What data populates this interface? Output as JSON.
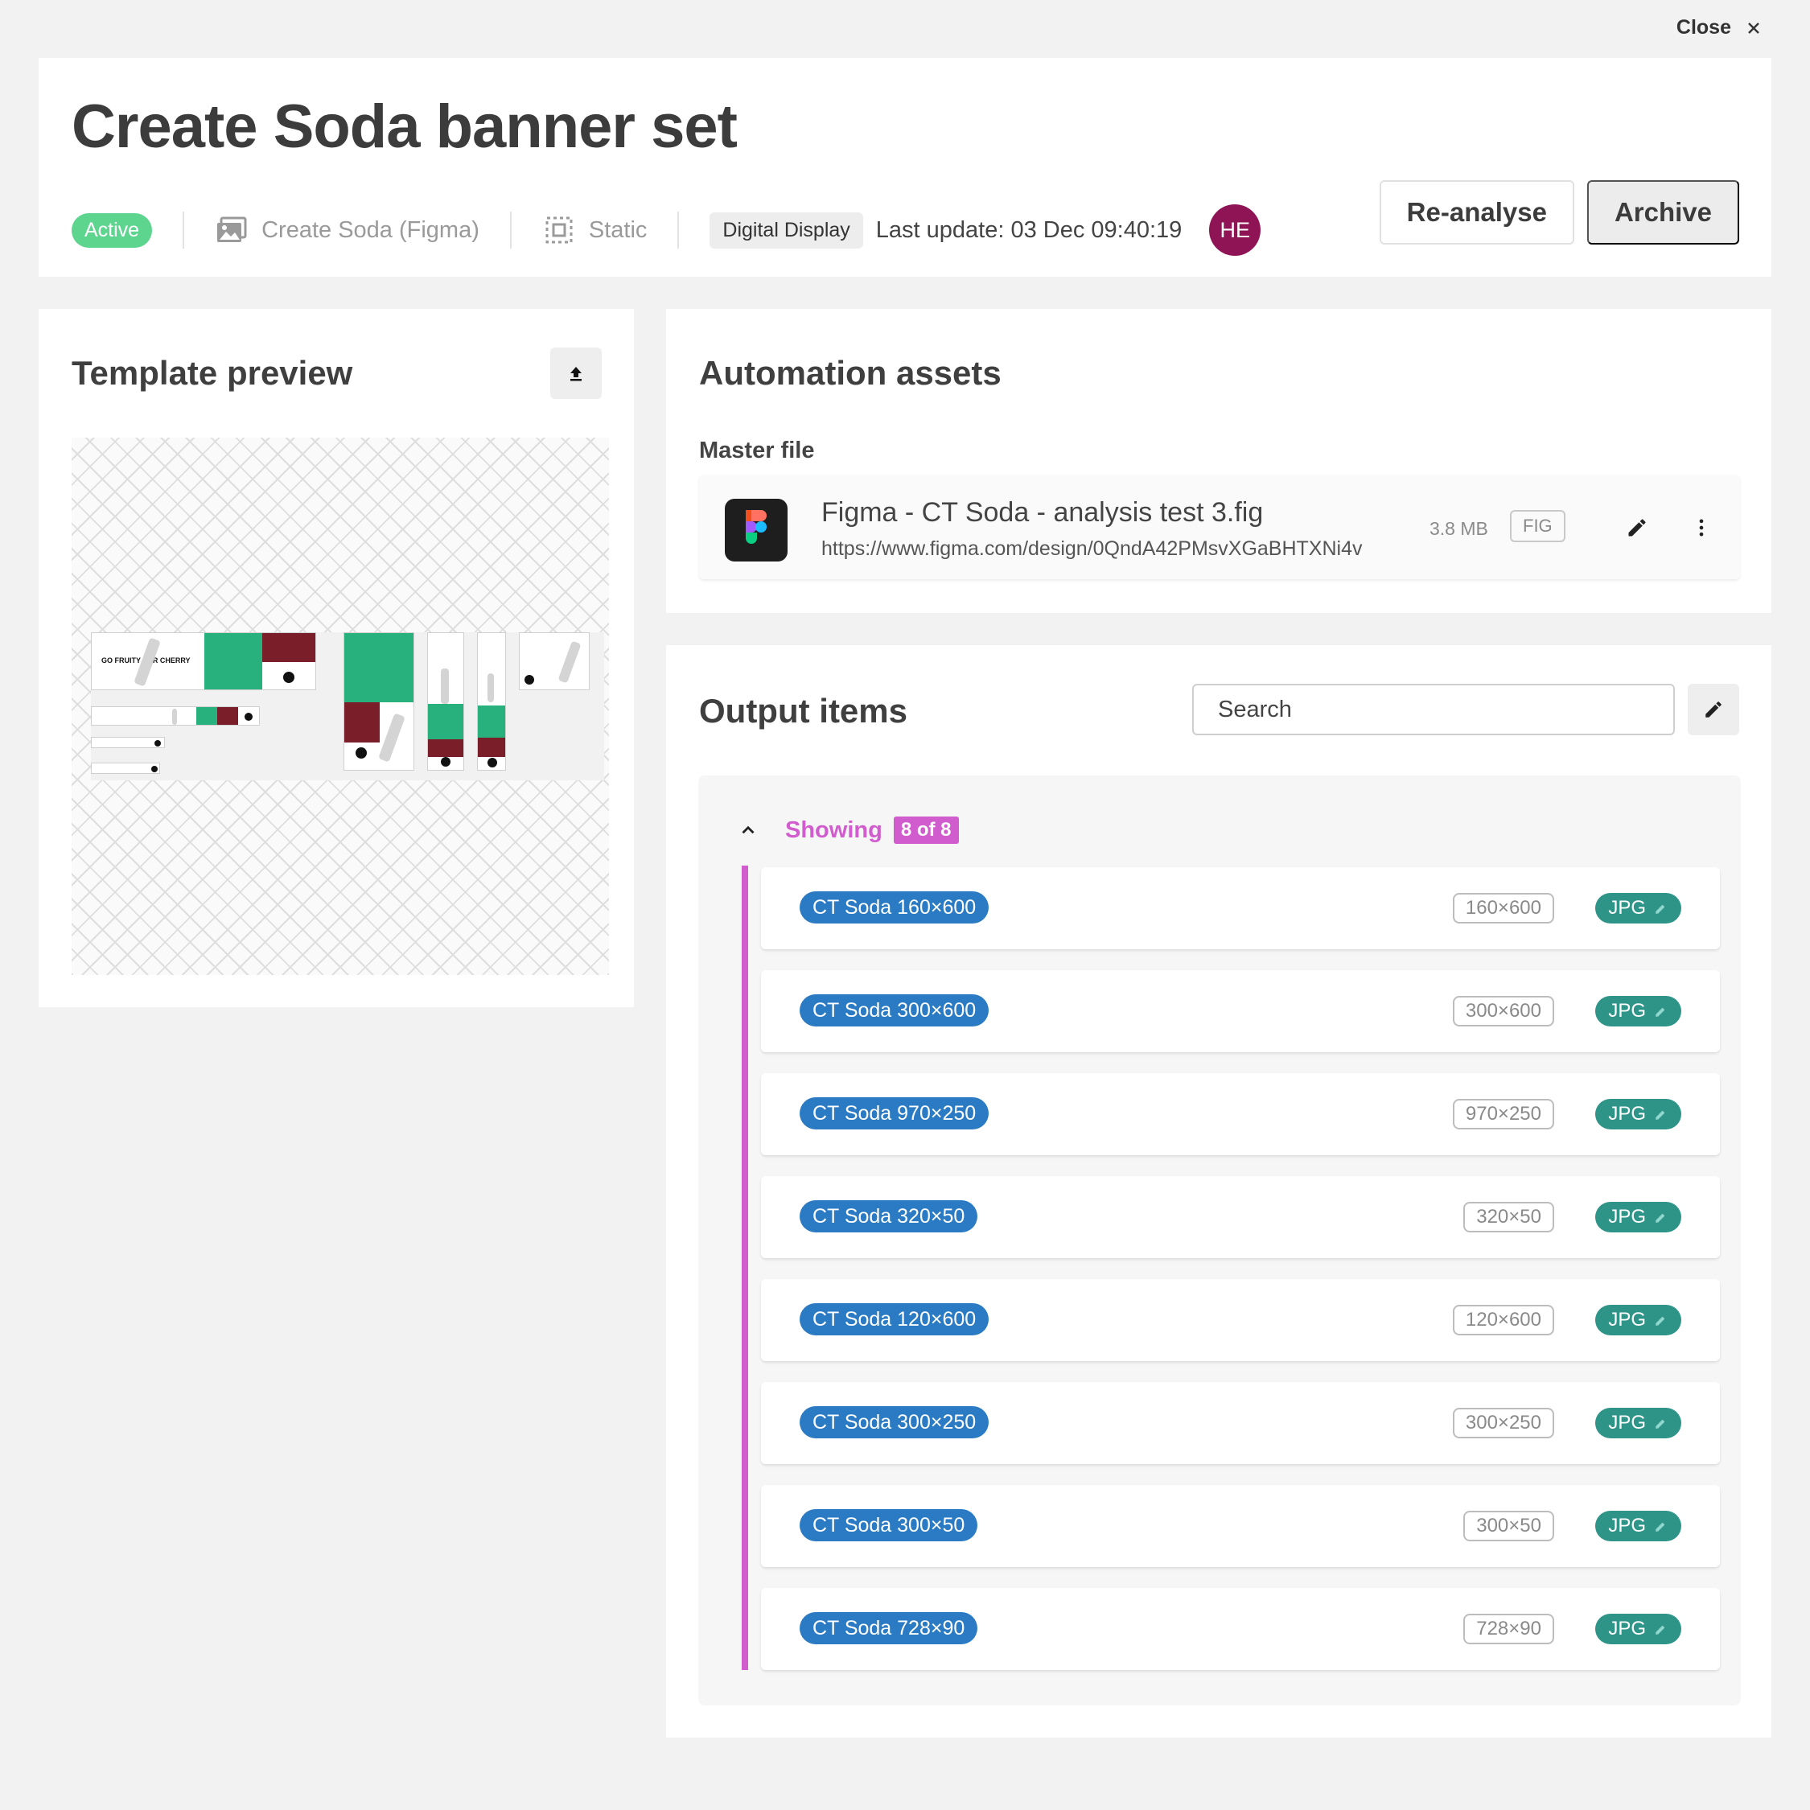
{
  "close": {
    "label": "Close"
  },
  "header": {
    "title": "Create Soda banner set",
    "status": "Active",
    "source": "Create Soda (Figma)",
    "type": "Static",
    "channel": "Digital Display",
    "last_update": "Last update: 03 Dec 09:40:19",
    "avatar": "HE",
    "reanalyse_label": "Re-analyse",
    "archive_label": "Archive"
  },
  "preview": {
    "title": "Template preview",
    "banner_text": "GO FRUITY FOR CHERRY"
  },
  "assets": {
    "title": "Automation assets",
    "master_label": "Master file",
    "file_name": "Figma - CT Soda - analysis test 3.fig",
    "file_url": "https://www.figma.com/design/0QndA42PMsvXGaBHTXNi4v",
    "file_size": "3.8 MB",
    "file_ext": "FIG"
  },
  "output": {
    "title": "Output items",
    "search_placeholder": "Search",
    "showing_label": "Showing",
    "showing_count": "8 of 8",
    "items": [
      {
        "name": "CT Soda 160×600",
        "dim": "160×600",
        "format": "JPG"
      },
      {
        "name": "CT Soda 300×600",
        "dim": "300×600",
        "format": "JPG"
      },
      {
        "name": "CT Soda 970×250",
        "dim": "970×250",
        "format": "JPG"
      },
      {
        "name": "CT Soda 320×50",
        "dim": "320×50",
        "format": "JPG"
      },
      {
        "name": "CT Soda 120×600",
        "dim": "120×600",
        "format": "JPG"
      },
      {
        "name": "CT Soda 300×250",
        "dim": "300×250",
        "format": "JPG"
      },
      {
        "name": "CT Soda 300×50",
        "dim": "300×50",
        "format": "JPG"
      },
      {
        "name": "CT Soda 728×90",
        "dim": "728×90",
        "format": "JPG"
      }
    ]
  },
  "colors": {
    "accent": "#d05ccd",
    "active": "#5dd58e",
    "item_name": "#2a7bc4",
    "format": "#2f9488",
    "avatar": "#8e1456"
  }
}
